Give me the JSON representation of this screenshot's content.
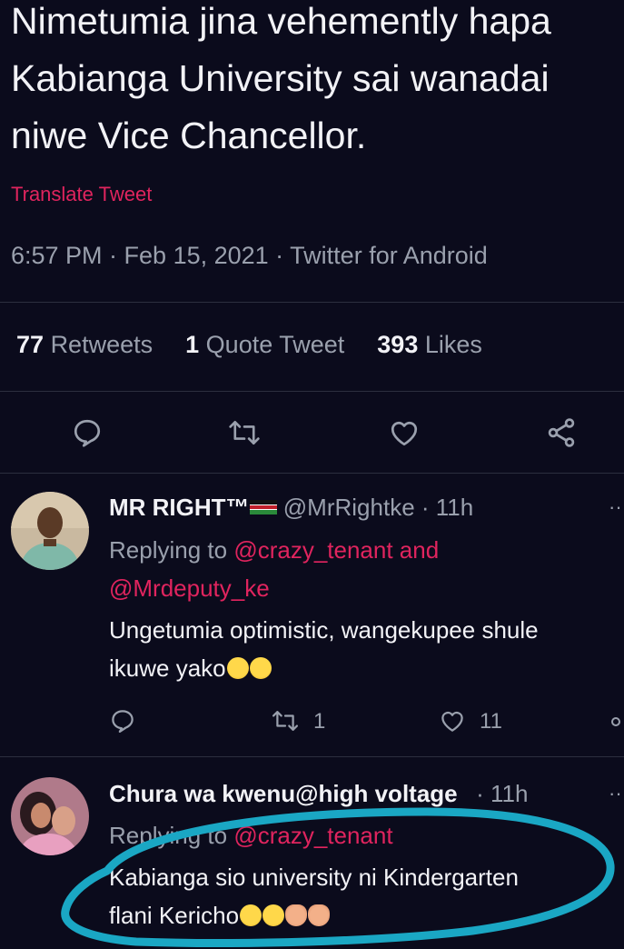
{
  "tweet": {
    "text": "Nimetumia jina vehemently hapa Kabianga University sai wanadai niwe Vice Chancellor.",
    "translate_label": "Translate Tweet",
    "meta": "6:57 PM · Feb 15, 2021 · Twitter for Android",
    "stats": {
      "retweets_count": "77",
      "retweets_label": "Retweets",
      "quotes_count": "1",
      "quotes_label": "Quote Tweet",
      "likes_count": "393",
      "likes_label": "Likes"
    },
    "actions": [
      "reply-icon",
      "retweet-icon",
      "like-icon",
      "share-icon"
    ]
  },
  "replies": [
    {
      "name": "MR RIGHT™",
      "flag": "kenya-flag-icon",
      "handle": "@MrRightke",
      "time": "· 11h",
      "replying_prefix": "Replying to",
      "replying_mention": "@crazy_tenant and",
      "replying_mention2": "@Mrdeputy_ke",
      "text_line1": "Ungetumia optimistic, wangekupee shule",
      "text_line2": "ikuwe yako",
      "retweets": "1",
      "likes": "11"
    },
    {
      "name": "Chura wa kwenu@high voltage",
      "time": "· 11h",
      "replying_prefix": "Replying to",
      "replying_mention": "@crazy_tenant",
      "text_line1": "Kabianga sio university ni Kindergarten",
      "text_line2": "flani Kericho"
    }
  ],
  "colors": {
    "background": "#0b0b1c",
    "accent_pink": "#e0245e",
    "muted": "#9aa0ad",
    "highlight": "#1aa7c4"
  }
}
